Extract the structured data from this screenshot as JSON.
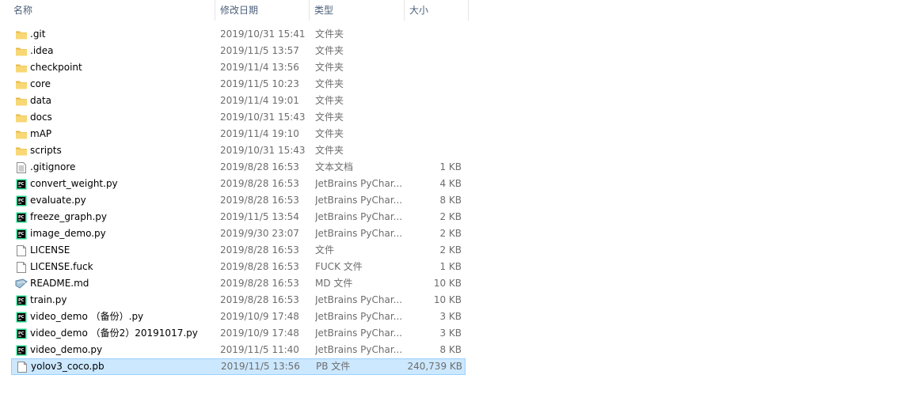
{
  "columns": {
    "name": "名称",
    "date": "修改日期",
    "type": "类型",
    "size": "大小"
  },
  "sort_indicator": "^",
  "files": [
    {
      "name": ".git",
      "date": "2019/10/31 15:41",
      "type": "文件夹",
      "size": "",
      "icon": "folder-icon"
    },
    {
      "name": ".idea",
      "date": "2019/11/5 13:57",
      "type": "文件夹",
      "size": "",
      "icon": "folder-icon"
    },
    {
      "name": "checkpoint",
      "date": "2019/11/4 13:56",
      "type": "文件夹",
      "size": "",
      "icon": "folder-icon"
    },
    {
      "name": "core",
      "date": "2019/11/5 10:23",
      "type": "文件夹",
      "size": "",
      "icon": "folder-icon"
    },
    {
      "name": "data",
      "date": "2019/11/4 19:01",
      "type": "文件夹",
      "size": "",
      "icon": "folder-icon"
    },
    {
      "name": "docs",
      "date": "2019/10/31 15:43",
      "type": "文件夹",
      "size": "",
      "icon": "folder-icon"
    },
    {
      "name": "mAP",
      "date": "2019/11/4 19:10",
      "type": "文件夹",
      "size": "",
      "icon": "folder-icon"
    },
    {
      "name": "scripts",
      "date": "2019/10/31 15:43",
      "type": "文件夹",
      "size": "",
      "icon": "folder-icon"
    },
    {
      "name": ".gitignore",
      "date": "2019/8/28 16:53",
      "type": "文本文档",
      "size": "1 KB",
      "icon": "text-file-icon"
    },
    {
      "name": "convert_weight.py",
      "date": "2019/8/28 16:53",
      "type": "JetBrains PyChar...",
      "size": "4 KB",
      "icon": "pycharm-file-icon"
    },
    {
      "name": "evaluate.py",
      "date": "2019/8/28 16:53",
      "type": "JetBrains PyChar...",
      "size": "8 KB",
      "icon": "pycharm-file-icon"
    },
    {
      "name": "freeze_graph.py",
      "date": "2019/11/5 13:54",
      "type": "JetBrains PyChar...",
      "size": "2 KB",
      "icon": "pycharm-file-icon"
    },
    {
      "name": "image_demo.py",
      "date": "2019/9/30 23:07",
      "type": "JetBrains PyChar...",
      "size": "2 KB",
      "icon": "pycharm-file-icon"
    },
    {
      "name": "LICENSE",
      "date": "2019/8/28 16:53",
      "type": "文件",
      "size": "2 KB",
      "icon": "blank-file-icon"
    },
    {
      "name": "LICENSE.fuck",
      "date": "2019/8/28 16:53",
      "type": "FUCK 文件",
      "size": "1 KB",
      "icon": "blank-file-icon"
    },
    {
      "name": "README.md",
      "date": "2019/8/28 16:53",
      "type": "MD 文件",
      "size": "10 KB",
      "icon": "markdown-file-icon"
    },
    {
      "name": "train.py",
      "date": "2019/8/28 16:53",
      "type": "JetBrains PyChar...",
      "size": "10 KB",
      "icon": "pycharm-file-icon"
    },
    {
      "name": "video_demo （备份）.py",
      "date": "2019/10/9 17:48",
      "type": "JetBrains PyChar...",
      "size": "3 KB",
      "icon": "pycharm-file-icon"
    },
    {
      "name": "video_demo （备份2）20191017.py",
      "date": "2019/10/9 17:48",
      "type": "JetBrains PyChar...",
      "size": "3 KB",
      "icon": "pycharm-file-icon"
    },
    {
      "name": "video_demo.py",
      "date": "2019/11/5 11:40",
      "type": "JetBrains PyChar...",
      "size": "8 KB",
      "icon": "pycharm-file-icon"
    },
    {
      "name": "yolov3_coco.pb",
      "date": "2019/11/5 13:56",
      "type": "PB 文件",
      "size": "240,739 KB",
      "icon": "blank-file-icon",
      "selected": true
    }
  ],
  "colors": {
    "selection_bg": "#cce8ff",
    "selection_border": "#99d1ff",
    "header_text": "#4c607a",
    "detail_text": "#6d6d6d",
    "folder": "#f8d775"
  }
}
